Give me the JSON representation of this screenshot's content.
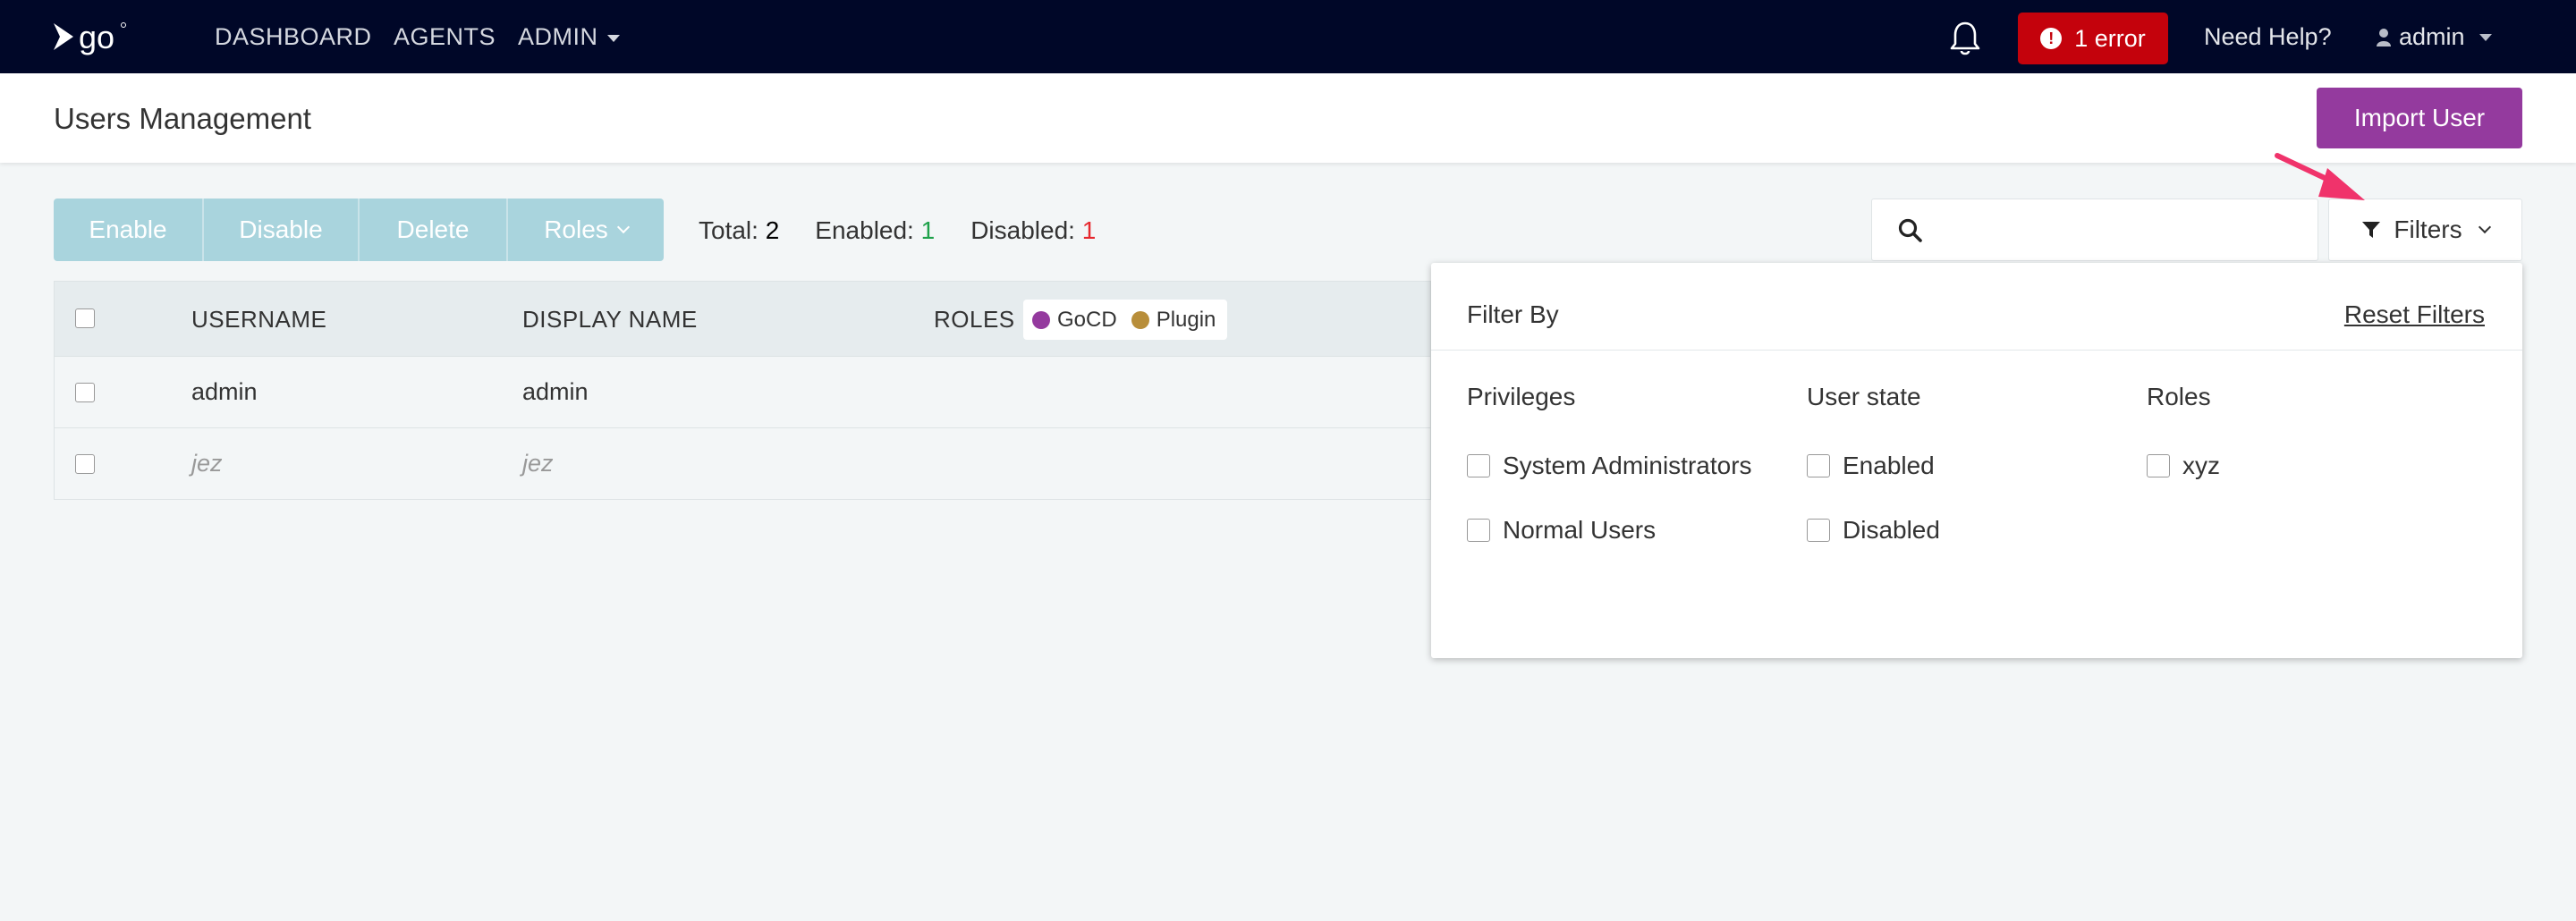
{
  "nav": {
    "links": [
      "DASHBOARD",
      "AGENTS",
      "ADMIN"
    ],
    "error_badge": "1 error",
    "help": "Need Help?",
    "user": "admin"
  },
  "header": {
    "title": "Users Management",
    "import_button": "Import User"
  },
  "toolbar": {
    "buttons": [
      "Enable",
      "Disable",
      "Delete",
      "Roles"
    ],
    "total_label": "Total:",
    "total": "2",
    "enabled_label": "Enabled:",
    "enabled": "1",
    "disabled_label": "Disabled:",
    "disabled": "1",
    "search_placeholder": "",
    "filters_label": "Filters"
  },
  "table": {
    "columns": [
      "USERNAME",
      "DISPLAY NAME",
      "ROLES"
    ],
    "legend": [
      {
        "label": "GoCD",
        "color": "#943a9e"
      },
      {
        "label": "Plugin",
        "color": "#b88e3a"
      }
    ],
    "rows": [
      {
        "username": "admin",
        "display_name": "admin",
        "enabled": true
      },
      {
        "username": "jez",
        "display_name": "jez",
        "enabled": false
      }
    ]
  },
  "filter_panel": {
    "title": "Filter By",
    "reset": "Reset Filters",
    "columns": [
      {
        "title": "Privileges",
        "options": [
          "System Administrators",
          "Normal Users"
        ]
      },
      {
        "title": "User state",
        "options": [
          "Enabled",
          "Disabled"
        ]
      },
      {
        "title": "Roles",
        "options": [
          "xyz"
        ]
      }
    ]
  },
  "colors": {
    "nav_bg": "#000728",
    "brand_purple": "#943a9e",
    "error_red": "#c4020c",
    "toolbar_button": "#a9d4dd",
    "annotation_arrow": "#f0336b"
  }
}
